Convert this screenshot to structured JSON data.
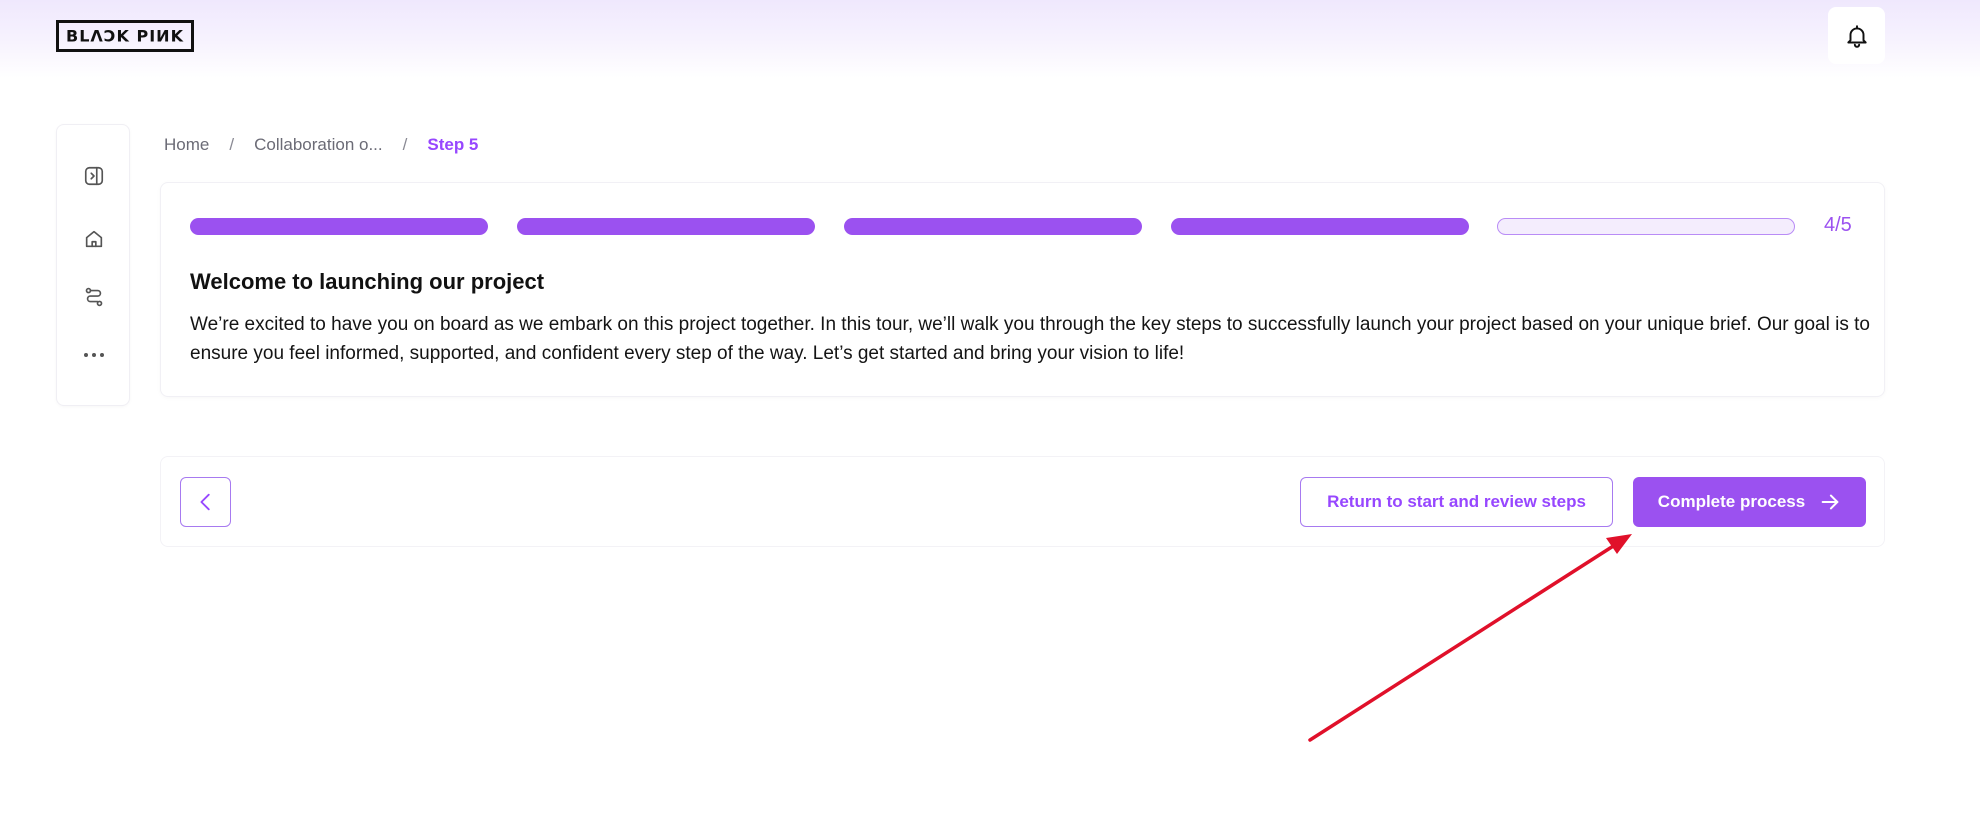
{
  "header": {
    "logo_text": "BLACKPINK",
    "notification_icon": "bell-icon"
  },
  "sidebar": {
    "items": [
      {
        "icon": "panel-toggle-icon"
      },
      {
        "icon": "home-icon"
      },
      {
        "icon": "route-icon"
      },
      {
        "icon": "more-horizontal-icon"
      }
    ]
  },
  "breadcrumb": {
    "items": [
      "Home",
      "Collaboration o...",
      "Step 5"
    ],
    "separator": "/"
  },
  "tour": {
    "progress": {
      "completed": 4,
      "total": 5,
      "label": "4/5"
    },
    "title": "Welcome to launching our project",
    "body": "We’re excited to have you on board as we embark on this project together. In this tour, we’ll walk you through the key steps to successfully launch your project based on your unique brief. Our goal is to ensure you feel informed, supported, and confident every step of the way. Let’s get started and bring your vision to life!"
  },
  "actions": {
    "back_icon": "chevron-left-icon",
    "review_label": "Return to start and review steps",
    "complete_label": "Complete process",
    "complete_icon": "arrow-right-icon"
  },
  "colors": {
    "accent": "#9b51f0",
    "accent_light": "#f4edfd",
    "annotation_arrow": "#e0102a"
  }
}
